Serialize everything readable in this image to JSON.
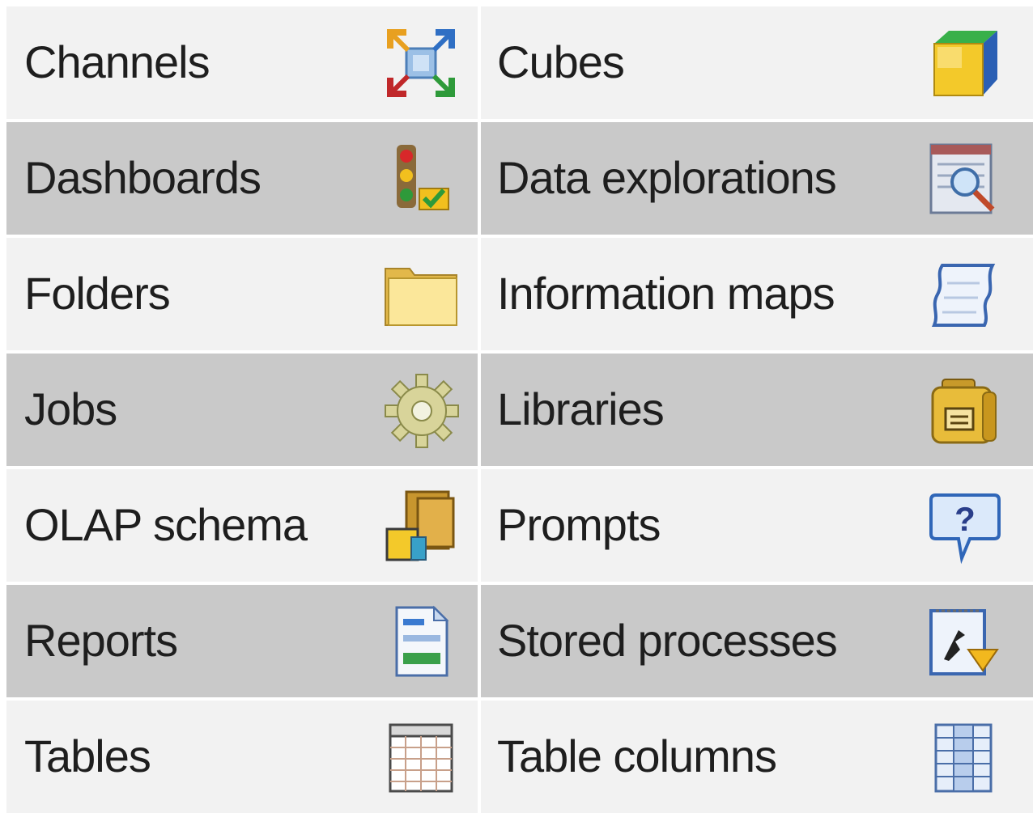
{
  "items": [
    {
      "label": "Channels",
      "icon": "channels-icon"
    },
    {
      "label": "Cubes",
      "icon": "cube-icon"
    },
    {
      "label": "Dashboards",
      "icon": "dashboard-icon"
    },
    {
      "label": "Data explorations",
      "icon": "data-exploration-icon"
    },
    {
      "label": "Folders",
      "icon": "folder-icon"
    },
    {
      "label": "Information maps",
      "icon": "information-map-icon"
    },
    {
      "label": "Jobs",
      "icon": "gear-icon"
    },
    {
      "label": "Libraries",
      "icon": "library-icon"
    },
    {
      "label": "OLAP schema",
      "icon": "olap-schema-icon"
    },
    {
      "label": "Prompts",
      "icon": "prompt-icon"
    },
    {
      "label": "Reports",
      "icon": "report-icon"
    },
    {
      "label": "Stored processes",
      "icon": "stored-process-icon"
    },
    {
      "label": "Tables",
      "icon": "table-icon"
    },
    {
      "label": "Table columns",
      "icon": "table-column-icon"
    }
  ],
  "colors": {
    "row_light": "#f2f2f2",
    "row_dark": "#c9c9c9",
    "text": "#1e1e1e"
  }
}
